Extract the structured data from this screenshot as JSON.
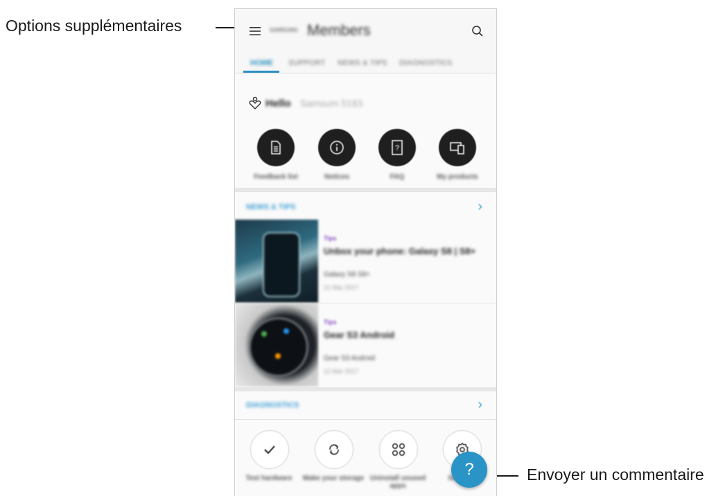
{
  "annotations": {
    "more_options": "Options supplémentaires",
    "feedback": "Envoyer un commentaire"
  },
  "header": {
    "brand_small": "SAMSUNG",
    "title": "Members",
    "menu_icon": "hamburger-menu-icon",
    "search_icon": "search-icon"
  },
  "tabs": [
    {
      "label": "HOME",
      "active": true
    },
    {
      "label": "SUPPORT",
      "active": false
    },
    {
      "label": "NEWS & TIPS",
      "active": false
    },
    {
      "label": "DIAGNOSTICS",
      "active": false
    }
  ],
  "greeting": {
    "text": "Hello",
    "name": "Samsum 5183",
    "icon": "profile-heart-icon"
  },
  "quick_actions": [
    {
      "label": "Feedback list",
      "icon": "document-icon"
    },
    {
      "label": "Notices",
      "icon": "info-icon"
    },
    {
      "label": "FAQ",
      "icon": "faq-icon"
    },
    {
      "label": "My products",
      "icon": "devices-icon"
    }
  ],
  "news_section": {
    "title": "NEWS & TIPS",
    "items": [
      {
        "category": "Tips",
        "title": "Unbox your phone: Galaxy S8 | S8+",
        "desc": "Galaxy S8 S8+",
        "date": "21 Mar 2017"
      },
      {
        "category": "Tips",
        "title": "Gear S3 Android",
        "desc": "Gear S3 Android",
        "date": "12 Mar 2017"
      }
    ]
  },
  "diagnostics_section": {
    "title": "DIAGNOSTICS",
    "items": [
      {
        "label": "Test hardware",
        "icon": "check-icon"
      },
      {
        "label": "Make your storage",
        "icon": "refresh-icon"
      },
      {
        "label": "Uninstall unused apps",
        "icon": "apps-grid-icon"
      },
      {
        "label": "Settings",
        "icon": "gear-icon"
      }
    ]
  },
  "fab": {
    "icon": "question-mark-icon",
    "glyph": "?"
  },
  "colors": {
    "accent": "#2a94c7",
    "tip_category": "#8a4bc2",
    "dark_circle": "#1f1f1f"
  }
}
